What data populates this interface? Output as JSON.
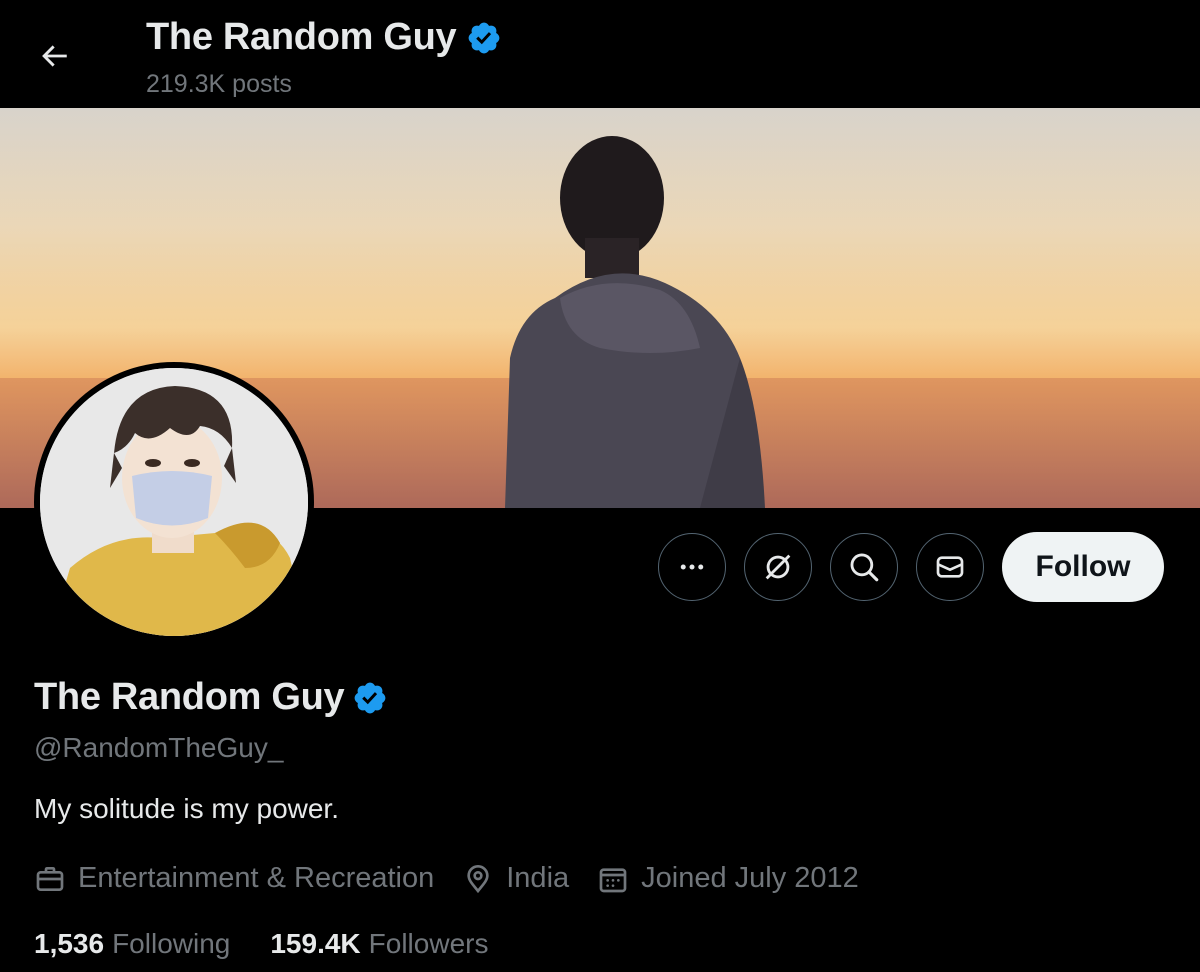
{
  "header": {
    "title": "The Random Guy",
    "posts_count": "219.3K posts"
  },
  "profile": {
    "display_name": "The Random Guy",
    "handle": "@RandomTheGuy_",
    "bio": "My solitude is my power.",
    "verified": true,
    "category": "Entertainment & Recreation",
    "location": "India",
    "joined": "Joined July 2012"
  },
  "actions": {
    "more_icon": "more-horizontal-icon",
    "grok_icon": "grok-icon",
    "search_icon": "search-icon",
    "message_icon": "envelope-icon",
    "follow_label": "Follow"
  },
  "stats": {
    "following_count": "1,536",
    "following_label": "Following",
    "followers_count": "159.4K",
    "followers_label": "Followers"
  },
  "colors": {
    "background": "#000000",
    "primary_text": "#e7e9ea",
    "secondary_text": "#71767b",
    "verified_blue": "#1d9bf0",
    "follow_button_bg": "#eff3f4"
  }
}
